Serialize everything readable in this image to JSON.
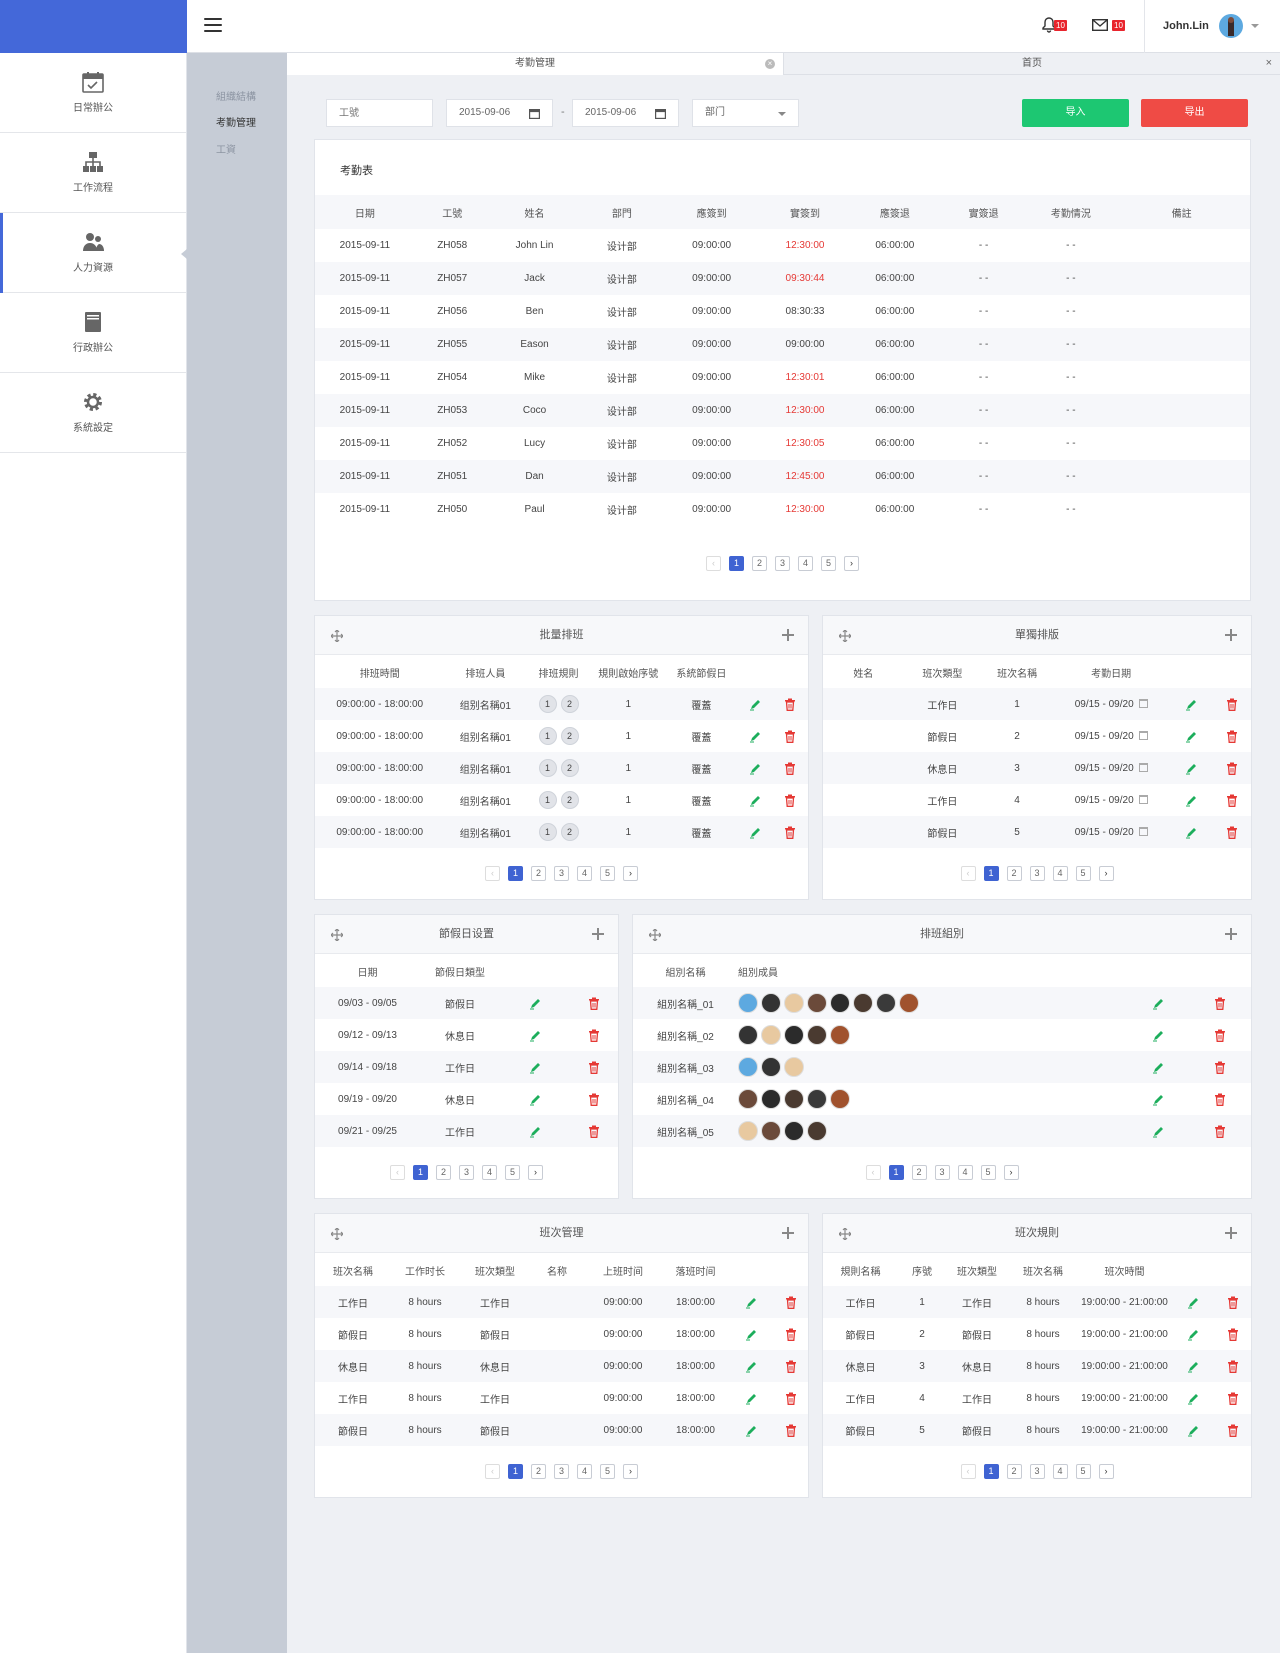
{
  "header": {
    "user_name": "John.Lin",
    "bell_count": "10",
    "mail_count": "10"
  },
  "sidebar": {
    "items": [
      {
        "label": "日常辦公",
        "icon": "calendar-icon"
      },
      {
        "label": "工作流程",
        "icon": "org-chart-icon"
      },
      {
        "label": "人力資源",
        "icon": "users-icon"
      },
      {
        "label": "行政辦公",
        "icon": "document-icon"
      },
      {
        "label": "系統設定",
        "icon": "gear-icon"
      }
    ]
  },
  "subnav": {
    "items": [
      "組織結構",
      "考勤管理",
      "工資"
    ]
  },
  "tabs": [
    {
      "label": "考勤管理"
    },
    {
      "label": "首页"
    }
  ],
  "filters": {
    "employee_id_placeholder": "工號",
    "date_from": "2015-09-06",
    "date_sep": "-",
    "date_to": "2015-09-06",
    "department": "部门",
    "import_label": "导入",
    "export_label": "导出"
  },
  "attendance": {
    "title": "考勤表",
    "headers": [
      "日期",
      "工號",
      "姓名",
      "部門",
      "應簽到",
      "實簽到",
      "應簽退",
      "實簽退",
      "考勤情況",
      "備註"
    ],
    "rows": [
      [
        "2015-09-11",
        "ZH058",
        "John Lin",
        "设计部",
        "09:00:00",
        "12:30:00",
        "06:00:00",
        "- -",
        "- -",
        ""
      ],
      [
        "2015-09-11",
        "ZH057",
        "Jack",
        "设计部",
        "09:00:00",
        "09:30:44",
        "06:00:00",
        "- -",
        "- -",
        ""
      ],
      [
        "2015-09-11",
        "ZH056",
        "Ben",
        "设计部",
        "09:00:00",
        "08:30:33",
        "06:00:00",
        "- -",
        "- -",
        ""
      ],
      [
        "2015-09-11",
        "ZH055",
        "Eason",
        "设计部",
        "09:00:00",
        "09:00:00",
        "06:00:00",
        "- -",
        "- -",
        ""
      ],
      [
        "2015-09-11",
        "ZH054",
        "Mike",
        "设计部",
        "09:00:00",
        "12:30:01",
        "06:00:00",
        "- -",
        "- -",
        ""
      ],
      [
        "2015-09-11",
        "ZH053",
        "Coco",
        "设计部",
        "09:00:00",
        "12:30:00",
        "06:00:00",
        "- -",
        "- -",
        ""
      ],
      [
        "2015-09-11",
        "ZH052",
        "Lucy",
        "设计部",
        "09:00:00",
        "12:30:05",
        "06:00:00",
        "- -",
        "- -",
        ""
      ],
      [
        "2015-09-11",
        "ZH051",
        "Dan",
        "设计部",
        "09:00:00",
        "12:45:00",
        "06:00:00",
        "- -",
        "- -",
        ""
      ],
      [
        "2015-09-11",
        "ZH050",
        "Paul",
        "设计部",
        "09:00:00",
        "12:30:00",
        "06:00:00",
        "- -",
        "- -",
        ""
      ]
    ],
    "late": [
      true,
      true,
      false,
      false,
      true,
      true,
      true,
      true,
      true
    ]
  },
  "pagination": [
    "1",
    "2",
    "3",
    "4",
    "5"
  ],
  "batch": {
    "title": "批量排班",
    "headers": [
      "排班時間",
      "排班人員",
      "排班規則",
      "規則啟始序號",
      "系統節假日"
    ],
    "rows": [
      [
        "09:00:00 - 18:00:00",
        "组别名稱01",
        "1",
        "2",
        "1",
        "覆蓋"
      ],
      [
        "09:00:00 - 18:00:00",
        "组别名稱01",
        "1",
        "2",
        "1",
        "覆蓋"
      ],
      [
        "09:00:00 - 18:00:00",
        "组别名稱01",
        "1",
        "2",
        "1",
        "覆蓋"
      ],
      [
        "09:00:00 - 18:00:00",
        "组别名稱01",
        "1",
        "2",
        "1",
        "覆蓋"
      ],
      [
        "09:00:00 - 18:00:00",
        "组别名稱01",
        "1",
        "2",
        "1",
        "覆蓋"
      ]
    ]
  },
  "single": {
    "title": "單獨排版",
    "headers": [
      "姓名",
      "班次類型",
      "班次名稱",
      "考勤日期"
    ],
    "rows": [
      [
        "",
        "工作日",
        "1",
        "09/15 - 09/20"
      ],
      [
        "",
        "節假日",
        "2",
        "09/15 - 09/20"
      ],
      [
        "",
        "休息日",
        "3",
        "09/15 - 09/20"
      ],
      [
        "",
        "工作日",
        "4",
        "09/15 - 09/20"
      ],
      [
        "",
        "節假日",
        "5",
        "09/15 - 09/20"
      ]
    ]
  },
  "holiday": {
    "title": "節假日设置",
    "headers": [
      "日期",
      "節假日類型"
    ],
    "rows": [
      [
        "09/03 - 09/05",
        "節假日"
      ],
      [
        "09/12 - 09/13",
        "休息日"
      ],
      [
        "09/14 - 09/18",
        "工作日"
      ],
      [
        "09/19 - 09/20",
        "休息日"
      ],
      [
        "09/21 - 09/25",
        "工作日"
      ]
    ]
  },
  "groups": {
    "title": "排班組別",
    "headers": [
      "組別名稱",
      "組別成員"
    ],
    "rows": [
      {
        "name": "組別名稱_01",
        "members": [
          "#5da9e0",
          "#333333",
          "#e8c9a0",
          "#6b4a3a",
          "#2b2b2b",
          "#4a3a30",
          "#3a3a3a",
          "#a0522d"
        ]
      },
      {
        "name": "組別名稱_02",
        "members": [
          "#333333",
          "#e8c9a0",
          "#2b2b2b",
          "#4a3a30",
          "#a0522d"
        ]
      },
      {
        "name": "組別名稱_03",
        "members": [
          "#5da9e0",
          "#333333",
          "#e8c9a0"
        ]
      },
      {
        "name": "組別名稱_04",
        "members": [
          "#6b4a3a",
          "#2b2b2b",
          "#4a3a30",
          "#3a3a3a",
          "#a0522d"
        ]
      },
      {
        "name": "組別名稱_05",
        "members": [
          "#e8c9a0",
          "#6b4a3a",
          "#2b2b2b",
          "#4a3a30"
        ]
      }
    ]
  },
  "shifts": {
    "title": "班次管理",
    "headers": [
      "班次名稱",
      "工作时长",
      "班次類型",
      "名称",
      "上班时间",
      "落班时间"
    ],
    "rows": [
      [
        "工作日",
        "8 hours",
        "工作日",
        "",
        "09:00:00",
        "18:00:00"
      ],
      [
        "節假日",
        "8 hours",
        "節假日",
        "",
        "09:00:00",
        "18:00:00"
      ],
      [
        "休息日",
        "8 hours",
        "休息日",
        "",
        "09:00:00",
        "18:00:00"
      ],
      [
        "工作日",
        "8 hours",
        "工作日",
        "",
        "09:00:00",
        "18:00:00"
      ],
      [
        "節假日",
        "8 hours",
        "節假日",
        "",
        "09:00:00",
        "18:00:00"
      ]
    ]
  },
  "rules": {
    "title": "班次規則",
    "headers": [
      "規則名稱",
      "序號",
      "班次類型",
      "班次名稱",
      "班次時間"
    ],
    "rows": [
      [
        "工作日",
        "1",
        "工作日",
        "8 hours",
        "19:00:00 - 21:00:00"
      ],
      [
        "節假日",
        "2",
        "節假日",
        "8 hours",
        "19:00:00 - 21:00:00"
      ],
      [
        "休息日",
        "3",
        "休息日",
        "8 hours",
        "19:00:00 - 21:00:00"
      ],
      [
        "工作日",
        "4",
        "工作日",
        "8 hours",
        "19:00:00 - 21:00:00"
      ],
      [
        "節假日",
        "5",
        "節假日",
        "8 hours",
        "19:00:00 - 21:00:00"
      ]
    ]
  },
  "colors": {
    "brand": "#4468d9",
    "import": "#1dc772",
    "export": "#ef4b45",
    "edit": "#1dae5c",
    "delete": "#e53935",
    "late": "#e53935"
  }
}
